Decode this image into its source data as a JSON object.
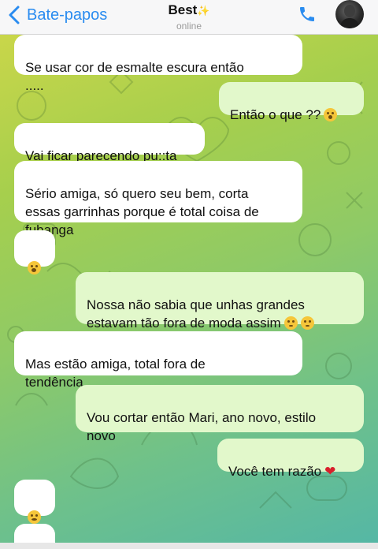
{
  "header": {
    "back_label": "Bate-papos",
    "contact_name": "Best",
    "status": "online"
  },
  "messages": [
    {
      "side": "in",
      "text": "Se usar cor de esmalte escura então\n....."
    },
    {
      "side": "out",
      "text": "Então o que ??"
    },
    {
      "side": "in",
      "text": "Vai ficar parecendo pu::ta"
    },
    {
      "side": "in",
      "text": "Sério amiga, só quero seu bem, corta\nessas garrinhas porque é total coisa de\nfubanga"
    },
    {
      "side": "in",
      "text": ""
    },
    {
      "side": "out",
      "text": "Nossa não sabia que unhas grandes\nestavam tão fora de moda assim"
    },
    {
      "side": "in",
      "text": "Mas estão amiga, total fora de\ntendência"
    },
    {
      "side": "out",
      "text": "Vou cortar então Mari, ano novo, estilo\nnovo"
    },
    {
      "side": "out",
      "text": "Você tem razão"
    },
    {
      "side": "in",
      "text": ""
    },
    {
      "side": "in",
      "text": ""
    }
  ],
  "colors": {
    "accent": "#2a8cf0",
    "incoming_bubble": "#ffffff",
    "outgoing_bubble": "#e2f8cb"
  }
}
